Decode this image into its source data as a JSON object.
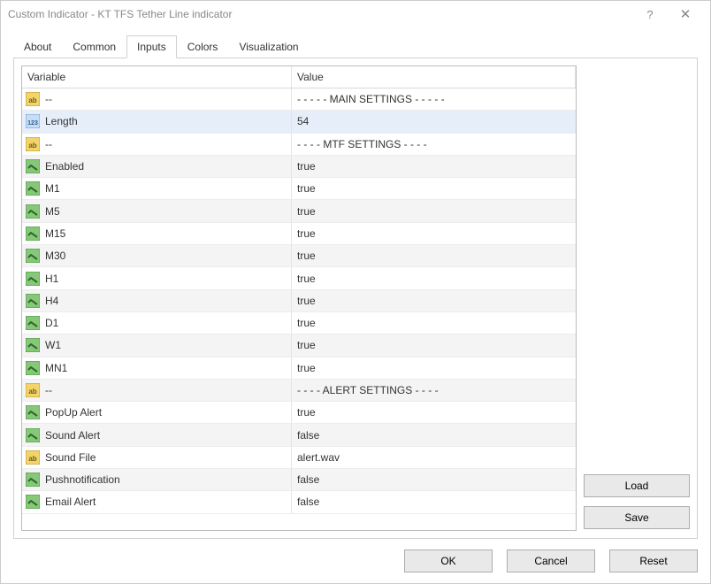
{
  "window": {
    "title": "Custom Indicator - KT TFS Tether Line indicator",
    "help_icon": "?",
    "close_icon": "✕"
  },
  "tabs": {
    "items": [
      {
        "label": "About"
      },
      {
        "label": "Common"
      },
      {
        "label": "Inputs",
        "active": true
      },
      {
        "label": "Colors"
      },
      {
        "label": "Visualization"
      }
    ]
  },
  "table": {
    "headers": {
      "variable": "Variable",
      "value": "Value"
    },
    "rows": [
      {
        "icon": "string",
        "name": "--",
        "value": "- - - - - MAIN SETTINGS - - - - -"
      },
      {
        "icon": "int",
        "name": "Length",
        "value": "54",
        "selected": true
      },
      {
        "icon": "string",
        "name": "--",
        "value": "- - - - MTF SETTINGS - - - -"
      },
      {
        "icon": "bool",
        "name": "Enabled",
        "value": "true"
      },
      {
        "icon": "bool",
        "name": "M1",
        "value": "true"
      },
      {
        "icon": "bool",
        "name": "M5",
        "value": "true"
      },
      {
        "icon": "bool",
        "name": "M15",
        "value": "true"
      },
      {
        "icon": "bool",
        "name": "M30",
        "value": "true"
      },
      {
        "icon": "bool",
        "name": "H1",
        "value": "true"
      },
      {
        "icon": "bool",
        "name": "H4",
        "value": "true"
      },
      {
        "icon": "bool",
        "name": "D1",
        "value": "true"
      },
      {
        "icon": "bool",
        "name": "W1",
        "value": "true"
      },
      {
        "icon": "bool",
        "name": "MN1",
        "value": "true"
      },
      {
        "icon": "string",
        "name": "--",
        "value": "- - - - ALERT SETTINGS - - - -"
      },
      {
        "icon": "bool",
        "name": "PopUp Alert",
        "value": "true"
      },
      {
        "icon": "bool",
        "name": "Sound Alert",
        "value": "false"
      },
      {
        "icon": "string",
        "name": "Sound File",
        "value": "alert.wav"
      },
      {
        "icon": "bool",
        "name": "Pushnotification",
        "value": "false"
      },
      {
        "icon": "bool",
        "name": "Email Alert",
        "value": "false"
      }
    ]
  },
  "buttons": {
    "load": "Load",
    "save": "Save",
    "ok": "OK",
    "cancel": "Cancel",
    "reset": "Reset"
  },
  "icons": {
    "string_tag": "ab",
    "int_tag": "123"
  }
}
